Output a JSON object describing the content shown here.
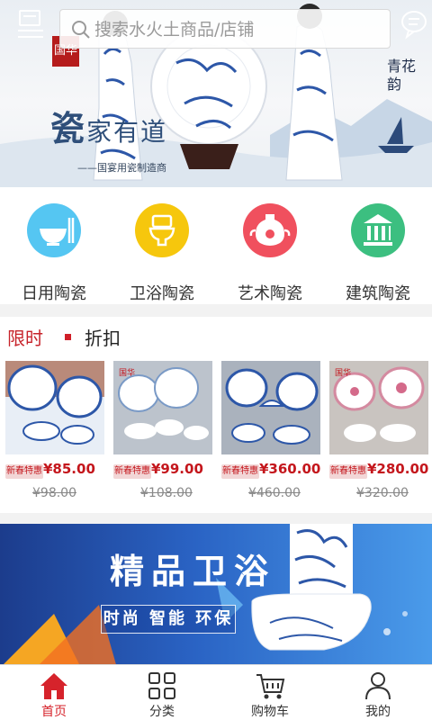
{
  "search": {
    "placeholder": "搜索水火土商品/店铺"
  },
  "hero": {
    "title_big": "瓷",
    "title_rest": "家有道",
    "subtitle": "——国宴用瓷制造商",
    "seal_text": "国华",
    "brush_text": "青花韵"
  },
  "categories": [
    {
      "label": "日用陶瓷",
      "icon": "bowl-icon",
      "color": "#55c6f2"
    },
    {
      "label": "卫浴陶瓷",
      "icon": "toilet-icon",
      "color": "#f6c70d"
    },
    {
      "label": "艺术陶瓷",
      "icon": "vase-icon",
      "color": "#f0505e"
    },
    {
      "label": "建筑陶瓷",
      "icon": "building-icon",
      "color": "#3cbf80"
    }
  ],
  "sale": {
    "title_left": "限时",
    "title_right": "折扣",
    "products": [
      {
        "tag": "新春特惠",
        "price": "¥85.00",
        "original": "¥98.00"
      },
      {
        "tag": "新春特惠",
        "price": "¥99.00",
        "original": "¥108.00"
      },
      {
        "tag": "新春特惠",
        "price": "¥360.00",
        "original": "¥460.00"
      },
      {
        "tag": "新春特惠",
        "price": "¥280.00",
        "original": "¥320.00"
      }
    ]
  },
  "promo": {
    "headline": "精品卫浴",
    "tagline": "时尚 智能 环保"
  },
  "nav": [
    {
      "label": "首页",
      "icon": "home-icon"
    },
    {
      "label": "分类",
      "icon": "grid-icon"
    },
    {
      "label": "购物车",
      "icon": "cart-icon"
    },
    {
      "label": "我的",
      "icon": "user-icon"
    }
  ],
  "colors": {
    "accent": "#d6232b",
    "price": "#c4161c",
    "promo_blue": "#2a63c4"
  }
}
